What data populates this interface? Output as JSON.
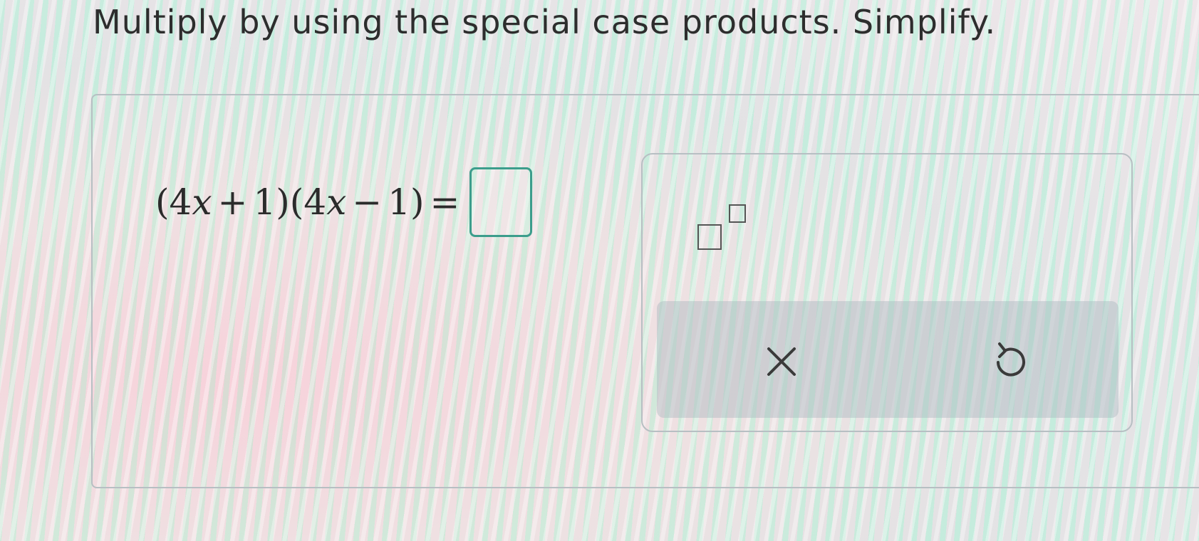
{
  "question": {
    "text": "Multiply by using the special case products. Simplify."
  },
  "equation": {
    "open1": "(",
    "coef1": "4",
    "var1": "x",
    "op1": "+",
    "const1": "1",
    "close1": ")",
    "open2": "(",
    "coef2": "4",
    "var2": "x",
    "op2": "−",
    "const2": "1",
    "close2": ")",
    "equals": "=",
    "answer_value": ""
  },
  "tools": {
    "exponent_template_icon": "exponent-template-icon",
    "clear_icon": "close-icon",
    "undo_icon": "undo-icon"
  },
  "colors": {
    "accent": "#3c9d8c",
    "text": "#2b2b2b",
    "action_bar": "#aab9be"
  }
}
